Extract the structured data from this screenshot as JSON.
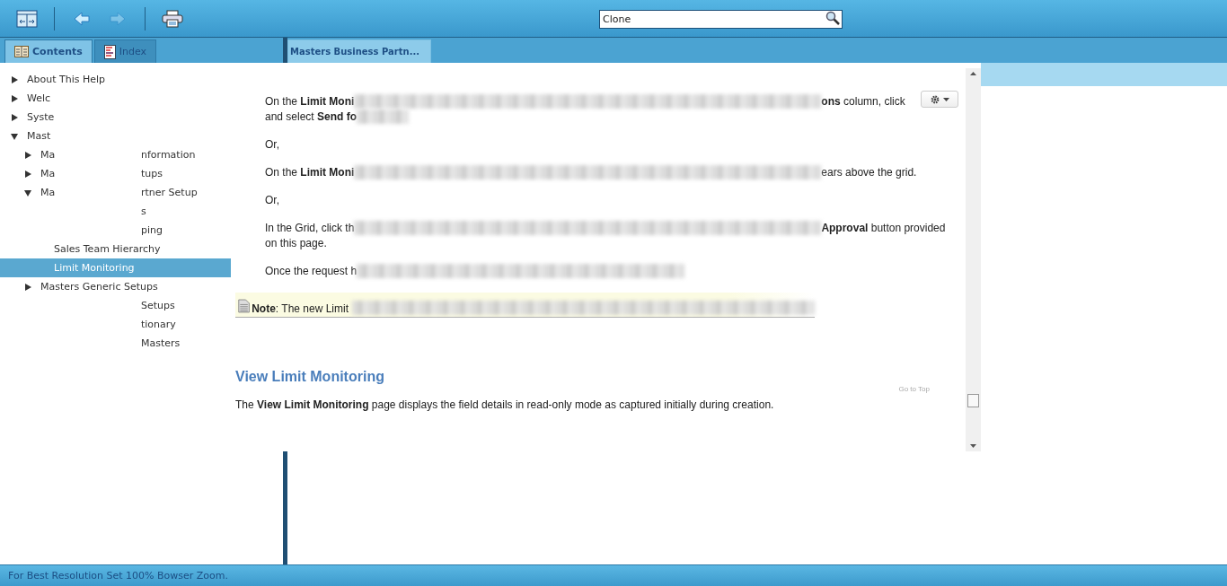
{
  "toolbar": [
    {
      "kind": "panes",
      "disabled": false
    },
    {
      "kind": "back",
      "disabled": false
    },
    {
      "kind": "forward",
      "disabled": true
    },
    {
      "kind": "print",
      "disabled": false
    }
  ],
  "search": {
    "value": "Clone"
  },
  "nav_tabs": [
    {
      "label": "Contents",
      "kind": "contents",
      "selected": true
    },
    {
      "label": "Index",
      "kind": "index",
      "selected": false
    }
  ],
  "doc_tabs": [
    {
      "label": "Masters Business Partn...",
      "selected": true
    }
  ],
  "tree": [
    {
      "label": "About This Help",
      "expanded": false,
      "selected": false
    },
    {
      "label": "Welc",
      "expanded": false,
      "selected": false
    },
    {
      "label": "Syste",
      "expanded": false,
      "selected": false
    },
    {
      "label": "Mast",
      "expanded": true,
      "selected": false,
      "children": [
        {
          "label": "Ma",
          "tail": "nformation",
          "expanded": false,
          "selected": false
        },
        {
          "label": "Ma",
          "tail": "tups",
          "expanded": false,
          "selected": false
        },
        {
          "label": "Ma",
          "tail": "rtner Setup",
          "expanded": true,
          "selected": false,
          "children": [
            {
              "tail": "s",
              "selected": false
            },
            {
              "tail": "ping",
              "selected": false
            },
            {
              "label": "Sales Team Hierarchy",
              "selected": false
            },
            {
              "label": "Limit Monitoring",
              "selected": true
            }
          ]
        },
        {
          "label": "Masters Generic Setups",
          "expanded": false,
          "selected": false
        },
        {
          "tail": "Setups",
          "selected": false
        },
        {
          "tail": "tionary",
          "selected": false
        },
        {
          "tail": "Masters",
          "selected": false
        }
      ]
    }
  ],
  "content": {
    "paragraphs": [
      {
        "lines": [
          {
            "before": "On the **Limit Moni**",
            "kind": "wide",
            "after": "**ons** column, click"
          },
          {
            "before": "and select **Send fo**",
            "kind": "narrow"
          }
        ]
      },
      {
        "lines": [
          {
            "before": "Or,",
            "kind": "plain"
          }
        ]
      },
      {
        "lines": [
          {
            "before": "On the **Limit Moni**",
            "kind": "wide",
            "after": "ears above the grid."
          }
        ]
      },
      {
        "lines": [
          {
            "before": "Or,",
            "kind": "plain"
          }
        ]
      },
      {
        "lines": [
          {
            "before": "In the Grid, click th",
            "kind": "wide",
            "after": "**Approval** button provided"
          },
          {
            "before": "on this page.",
            "kind": "plain"
          }
        ]
      },
      {
        "lines": [
          {
            "before": "Once the request h",
            "kind": "medium"
          }
        ]
      }
    ],
    "note": {
      "text": "**Note**: The new Limit"
    },
    "heading": "View Limit Monitoring",
    "go_to_top": "Go to Top",
    "body": "The **View Limit Monitoring** page displays the field details in read-only mode as captured initially during creation."
  },
  "status_bar": "For Best Resolution Set 100% Bowser Zoom."
}
